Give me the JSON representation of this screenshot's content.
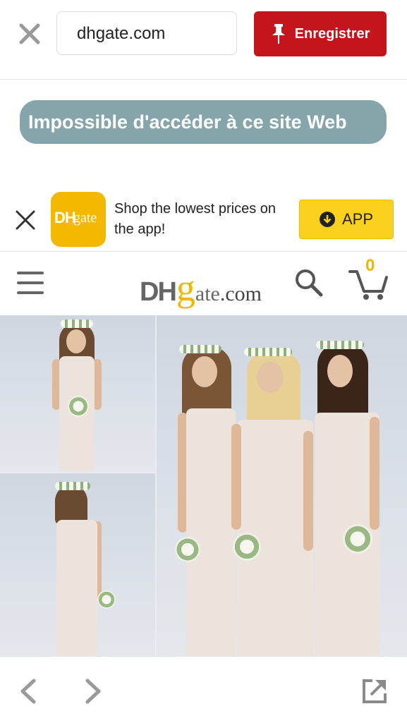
{
  "browser": {
    "url": "dhgate.com",
    "save_button": {
      "label": "Enregistrer",
      "icon": "pushpin-icon",
      "color": "#c4151c"
    },
    "close_icon": "close-icon"
  },
  "error": {
    "message": "Impossible d'accéder à ce site Web",
    "color": "#86a5aa"
  },
  "app_banner": {
    "icon_text_dh": "DH",
    "icon_text_gate": "gate",
    "text": "Shop the lowest prices on the app!",
    "button_label": "APP",
    "button_icon": "download-arrow-icon",
    "button_color": "#fbd11d"
  },
  "site_header": {
    "logo_dh": "DH",
    "logo_g": "g",
    "logo_ate": "ate",
    "logo_com": ".com",
    "menu_icon": "hamburger-menu-icon",
    "search_icon": "search-icon",
    "cart_icon": "cart-icon",
    "cart_count": "0",
    "accent_color": "#f2b600"
  },
  "bottom_toolbar": {
    "back_icon": "chevron-left-icon",
    "forward_icon": "chevron-right-icon",
    "share_icon": "open-external-icon"
  }
}
